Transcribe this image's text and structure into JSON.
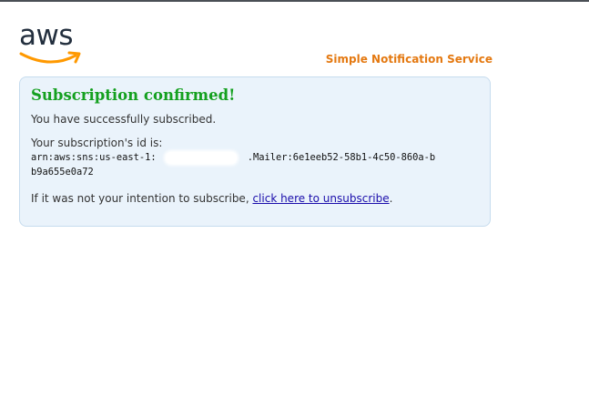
{
  "brand": {
    "logo_text": "aws",
    "service_name": "Simple Notification Service"
  },
  "colors": {
    "logo_text": "#232f3e",
    "logo_smile": "#ff9900",
    "service_name": "#e47911",
    "title": "#14a01f",
    "panel_background": "#eaf3fb",
    "link": "#1a0dab"
  },
  "confirmation": {
    "title": "Subscription confirmed!",
    "message": "You have successfully subscribed.",
    "id_label": "Your subscription's id is:",
    "subscription_arn": "arn:aws:sns:us-east-1:                .Mailer:6e1eeb52-58b1-4c50-860a-bb9a655e0a72",
    "unsubscribe_prefix": "If it was not your intention to subscribe, ",
    "unsubscribe_link": "click here to unsubscribe",
    "unsubscribe_suffix": "."
  }
}
